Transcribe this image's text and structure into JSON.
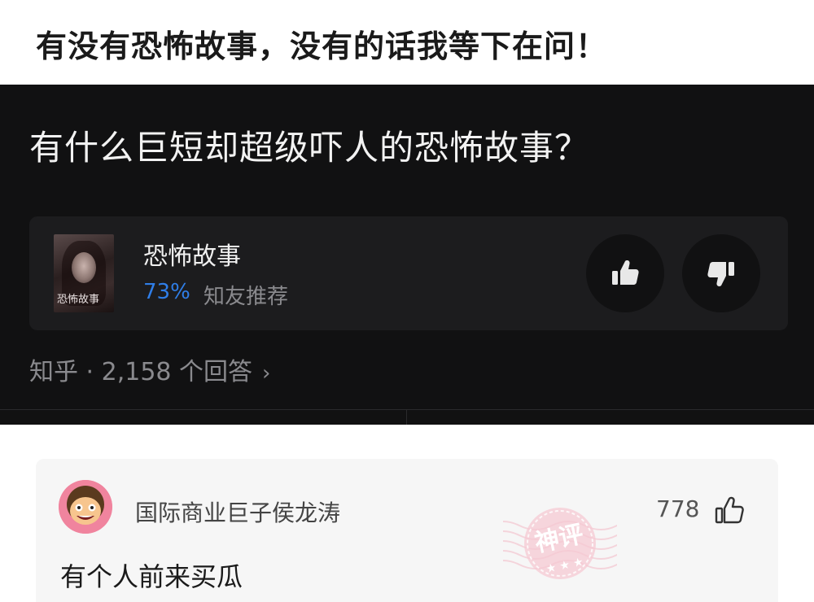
{
  "post": {
    "title": "有没有恐怖故事，没有的话我等下在问！"
  },
  "question": {
    "title": "有什么巨短却超级吓人的恐怖故事？"
  },
  "topic": {
    "cover_text": "恐怖故事",
    "name": "恐怖故事",
    "percent": "73%",
    "recommend_label": "知友推荐",
    "accent_color": "#2f7ee8"
  },
  "vote": {
    "up_icon": "thumbs-up-icon",
    "down_icon": "thumbs-down-icon"
  },
  "meta": {
    "text": "知乎 · 2,158 个回答",
    "chevron": "›"
  },
  "comment": {
    "username": "国际商业巨子侯龙涛",
    "likes": "778",
    "text": "有个人前来买瓜",
    "stamp_text": "神评",
    "stamp_color": "#e35b7a"
  }
}
